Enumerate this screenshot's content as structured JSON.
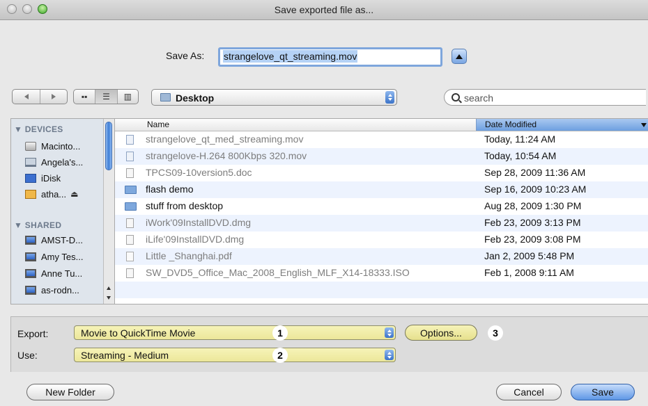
{
  "window": {
    "title": "Save exported file as..."
  },
  "save_as": {
    "label": "Save As:",
    "filename": "strangelove_qt_streaming.mov"
  },
  "location": {
    "current": "Desktop"
  },
  "search": {
    "placeholder": "search"
  },
  "sidebar": {
    "sections": [
      {
        "title": "▼ DEVICES",
        "items": [
          {
            "label": "Macinto...",
            "icon": "hard-disk-icon"
          },
          {
            "label": "Angela's...",
            "icon": "laptop-icon"
          },
          {
            "label": "iDisk",
            "icon": "idisk-icon"
          },
          {
            "label": "atha...",
            "icon": "user-folder-icon",
            "eject": "⏏"
          }
        ]
      },
      {
        "title": "▼ SHARED",
        "items": [
          {
            "label": "AMST-D...",
            "icon": "network-computer-icon"
          },
          {
            "label": "Amy Tes...",
            "icon": "network-computer-icon"
          },
          {
            "label": "Anne Tu...",
            "icon": "network-computer-icon"
          },
          {
            "label": "as-rodn...",
            "icon": "network-computer-icon"
          }
        ]
      }
    ]
  },
  "file_list": {
    "columns": {
      "name": "Name",
      "date": "Date Modified"
    },
    "rows": [
      {
        "name": "strangelove_qt_med_streaming.mov",
        "date": "Today, 11:24 AM",
        "kind": "mov",
        "enabled": false
      },
      {
        "name": "strangelove-H.264 800Kbps 320.mov",
        "date": "Today, 10:54 AM",
        "kind": "mov",
        "enabled": false
      },
      {
        "name": "TPCS09-10version5.doc",
        "date": "Sep 28, 2009 11:36 AM",
        "kind": "doc",
        "enabled": false
      },
      {
        "name": "flash demo",
        "date": "Sep 16, 2009 10:23 AM",
        "kind": "folder",
        "enabled": true
      },
      {
        "name": "stuff from desktop",
        "date": "Aug 28, 2009 1:30 PM",
        "kind": "folder",
        "enabled": true
      },
      {
        "name": "iWork'09InstallDVD.dmg",
        "date": "Feb 23, 2009 3:13 PM",
        "kind": "dmg",
        "enabled": false
      },
      {
        "name": "iLife'09InstallDVD.dmg",
        "date": "Feb 23, 2009 3:08 PM",
        "kind": "dmg",
        "enabled": false
      },
      {
        "name": "Little _Shanghai.pdf",
        "date": "Jan 2, 2009 5:48 PM",
        "kind": "pdf",
        "enabled": false
      },
      {
        "name": "SW_DVD5_Office_Mac_2008_English_MLF_X14-18333.ISO",
        "date": "Feb 1, 2008 9:11 AM",
        "kind": "iso",
        "enabled": false
      }
    ]
  },
  "options": {
    "export_label": "Export:",
    "export_value": "Movie to QuickTime Movie",
    "use_label": "Use:",
    "use_value": "Streaming - Medium",
    "options_button": "Options...",
    "callouts": [
      "1",
      "2",
      "3"
    ]
  },
  "buttons": {
    "new_folder": "New Folder",
    "cancel": "Cancel",
    "save": "Save"
  },
  "colors": {
    "selection_blue": "#6d9fe0",
    "highlight_yellow": "#ece79a",
    "row_alt": "#edf3fe"
  }
}
